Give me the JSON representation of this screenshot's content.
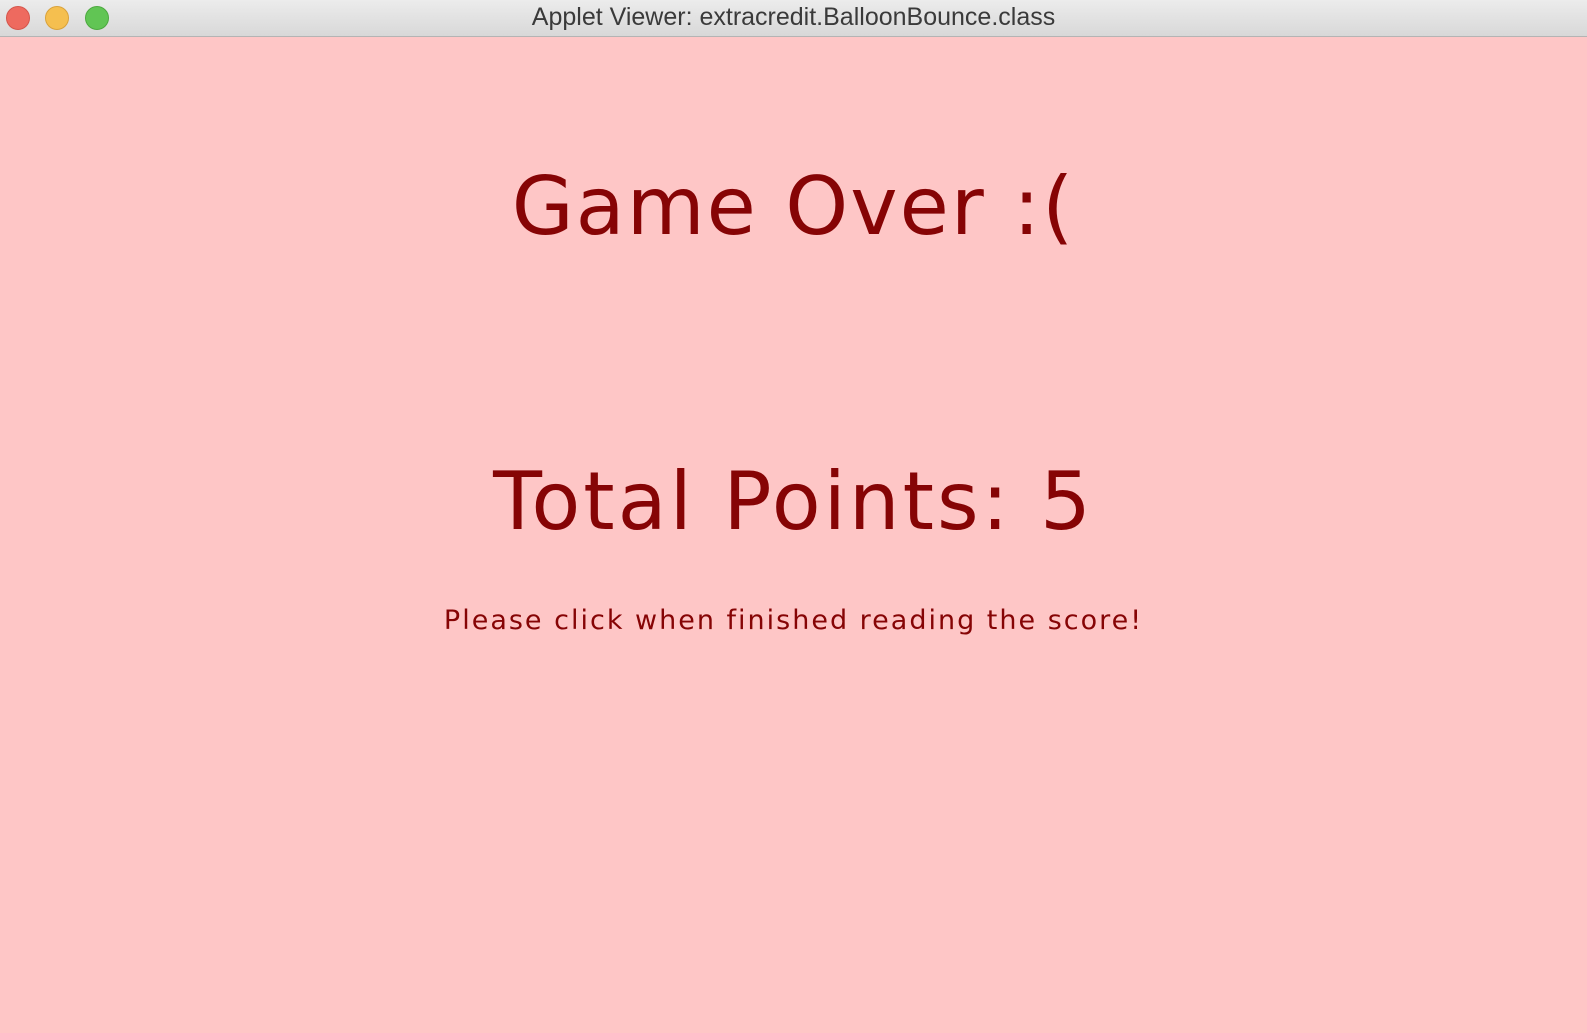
{
  "window": {
    "title": "Applet Viewer: extracredit.BalloonBounce.class",
    "controls": {
      "close_icon": "close-icon",
      "minimize_icon": "minimize-icon",
      "zoom_icon": "zoom-icon"
    }
  },
  "game": {
    "heading": "Game Over :(",
    "total_points": "Total Points: 5",
    "score": 5,
    "instruction": "Please click when finished reading the score!"
  },
  "colors": {
    "background": "#fec6c6",
    "text": "#860405",
    "titlebar": "#e3e3e3",
    "close": "#ee6a5f",
    "minimize": "#f5bf4f",
    "zoom": "#61c554"
  }
}
